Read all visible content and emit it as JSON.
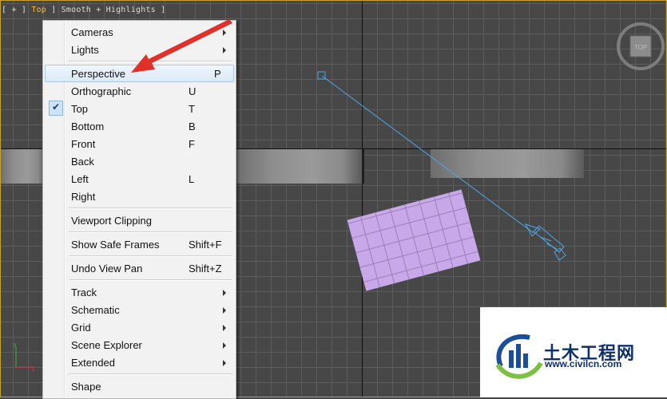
{
  "viewport": {
    "label_bracket_open": "[ + ] ",
    "label_view": "Top",
    "label_rest": " ] Smooth + Highlights ]",
    "viewcube_face": "TOP"
  },
  "menu": {
    "items": [
      {
        "label": "Cameras",
        "key": "",
        "submenu": true
      },
      {
        "label": "Lights",
        "key": "",
        "submenu": true
      },
      {
        "label": "Perspective",
        "key": "P",
        "hover": true
      },
      {
        "label": "Orthographic",
        "key": "U"
      },
      {
        "label": "Top",
        "key": "T",
        "checked": true
      },
      {
        "label": "Bottom",
        "key": "B"
      },
      {
        "label": "Front",
        "key": "F"
      },
      {
        "label": "Back",
        "key": ""
      },
      {
        "label": "Left",
        "key": "L"
      },
      {
        "label": "Right",
        "key": ""
      },
      {
        "label": "Viewport Clipping",
        "key": ""
      },
      {
        "label": "Show Safe Frames",
        "key": "Shift+F"
      },
      {
        "label": "Undo View Pan",
        "key": "Shift+Z"
      },
      {
        "label": "Track",
        "key": "",
        "submenu": true
      },
      {
        "label": "Schematic",
        "key": "",
        "submenu": true
      },
      {
        "label": "Grid",
        "key": "",
        "submenu": true
      },
      {
        "label": "Scene Explorer",
        "key": "",
        "submenu": true
      },
      {
        "label": "Extended",
        "key": "",
        "submenu": true
      },
      {
        "label": "Shape",
        "key": ""
      }
    ]
  },
  "colors": {
    "annotation_arrow": "#e0302a",
    "camera_line": "#4aa8e8",
    "plane": "#c8a8e8",
    "viewport_border": "#c9a227"
  },
  "watermark": {
    "name": "土木工程网",
    "url": "www.civilcn.com"
  }
}
